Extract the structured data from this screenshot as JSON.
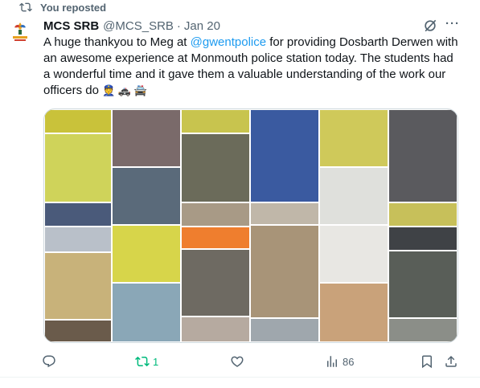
{
  "repost": {
    "label": "You reposted"
  },
  "tweet": {
    "author_name": "MCS SRB",
    "handle": "@MCS_SRB",
    "separator": "·",
    "date": "Jan 20",
    "text_before_link": "A huge thankyou to Meg at ",
    "link_text": "@gwentpolice",
    "text_after_link": "  for providing Dosbarth Derwen with an awesome experience at Monmouth police station today. The students had a wonderful time and it gave them a valuable understanding of the work our officers do",
    "emojis": "👮 🚓 🚔",
    "more_label": "···"
  },
  "actions": {
    "reply_count": "",
    "repost_count": "1",
    "like_count": "",
    "views_count": "86"
  },
  "colors": {
    "accent": "#1d9bf0",
    "repost_green": "#00ba7c",
    "muted": "#536471"
  },
  "icons": [
    "repost-icon",
    "grok-icon",
    "more-icon",
    "reply-icon",
    "like-icon",
    "views-icon",
    "bookmark-icon",
    "share-icon"
  ]
}
